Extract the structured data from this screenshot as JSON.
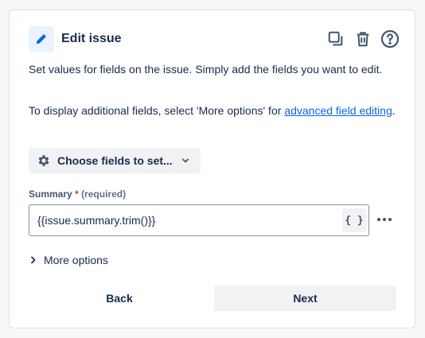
{
  "header": {
    "title": "Edit issue",
    "icon": "pencil-icon",
    "actions": [
      "copy-icon",
      "trash-icon",
      "help-icon"
    ]
  },
  "description": {
    "line1": "Set values for fields on the issue. Simply add the fields you want to edit.",
    "line2_prefix": "To display additional fields, select 'More options' for ",
    "line2_link": "advanced field editing",
    "line2_suffix": "."
  },
  "choose_fields": {
    "label": "Choose fields to set...",
    "icon": "gear-icon"
  },
  "summary_field": {
    "label": "Summary",
    "required_marker": "*",
    "hint": "(required)",
    "value": "{{issue.summary.trim()}}",
    "code_button": "{ }"
  },
  "more_options": {
    "label": "More options"
  },
  "footer": {
    "back_label": "Back",
    "next_label": "Next"
  },
  "colors": {
    "accent": "#0c66e4",
    "icon_blue": "#0c66e4",
    "required": "#c9372c",
    "button_bg": "#f1f2f4"
  }
}
